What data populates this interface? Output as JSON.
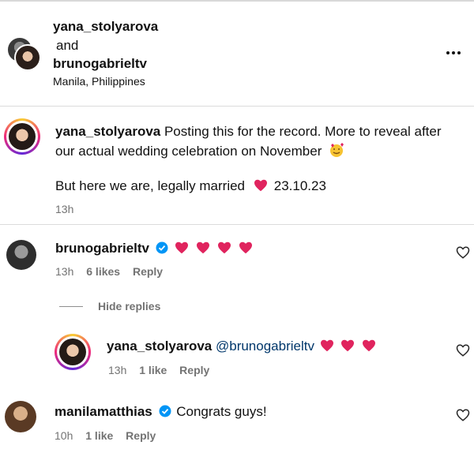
{
  "header": {
    "user1": "yana_stolyarova",
    "and_text": "and",
    "user2": "brunogabrieltv",
    "location": "Manila, Philippines",
    "more_icon": "more-horizontal-icon"
  },
  "caption": {
    "username": "yana_stolyarova",
    "line1": " Posting this for the record. More to reveal after",
    "line2": "our actual wedding celebration on November",
    "line3": "But here we are, legally married",
    "date": "23.10.23",
    "time": "13h"
  },
  "comments": [
    {
      "username": "brunogabrieltv",
      "verified": true,
      "text": "",
      "hearts": 4,
      "time": "13h",
      "likes": "6 likes",
      "reply": "Reply"
    },
    {
      "username": "yana_stolyarova",
      "mention": "@brunogabrieltv",
      "hearts": 3,
      "time": "13h",
      "likes": "1 like",
      "reply": "Reply"
    },
    {
      "username": "manilamatthias",
      "verified": true,
      "text": "Congrats guys!",
      "time": "10h",
      "likes": "1 like",
      "reply": "Reply"
    }
  ],
  "replies_toggle": "Hide replies",
  "colors": {
    "heart": "#e0245e",
    "verified": "#0095f6",
    "muted": "#737373"
  }
}
